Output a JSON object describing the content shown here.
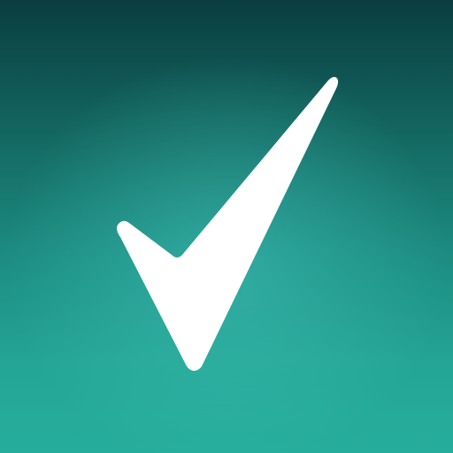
{
  "icon": {
    "name": "checkmark-icon",
    "glyph_color": "#ffffff",
    "background_colors": [
      "#0a3d40",
      "#1c8a80",
      "#27ad9c"
    ]
  }
}
